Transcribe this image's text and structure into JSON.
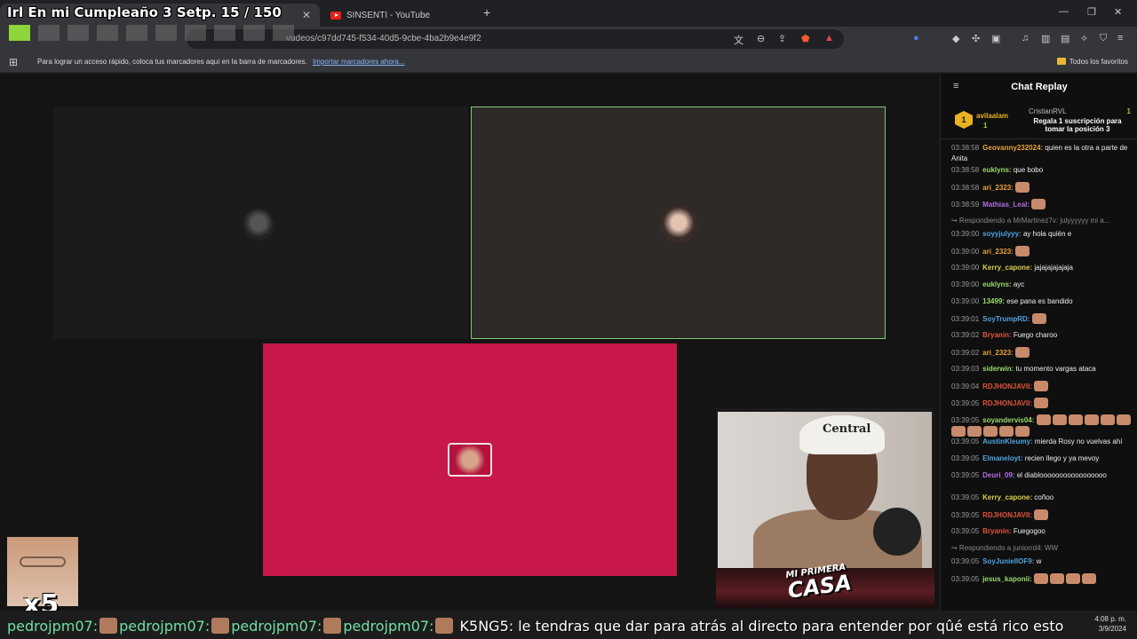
{
  "overlay": {
    "title": "Irl En mi Cumpleaño 3 Setp. 15 / 150",
    "progress_filled": 1,
    "progress_total": 10,
    "accent": "#8ed43b"
  },
  "browser": {
    "tabs": [
      {
        "label": "",
        "active": true
      },
      {
        "label": "SINSENTI - YouTube",
        "active": false
      }
    ],
    "new_tab_icon": "+",
    "url": "vudeos/c97dd745-f534-40d5-9cbe-4ba2b9e4e9f2",
    "bookmarks": {
      "hint": "Para lograr un acceso rápido, coloca tus marcadores aquí en la barra de marcadores.",
      "import": "Importar marcadores ahora...",
      "all": "Todos los favoritos"
    }
  },
  "call": {
    "active_border": "#7fc97a",
    "tile3_color": "#c8174a"
  },
  "webcam": {
    "cap_text": "Central",
    "brand_line1": "MI PRIMERA",
    "brand_line2": "CASA"
  },
  "smallcam": {
    "multiplier": "x5"
  },
  "chat": {
    "title": "Chat Replay",
    "pinned": {
      "rank": "1",
      "user": "avilaalam",
      "count": "1",
      "giver": "CristianRVL",
      "giver_count": "1",
      "message": "Regala 1 suscripción para tomar la posición 3"
    },
    "messages": [
      {
        "ts": "03:38:58",
        "user": "Geovanny232024",
        "color": "#e8a33b",
        "text": "quien es la otra a parte de Anita",
        "wrap": true
      },
      {
        "ts": "03:38:58",
        "user": "euklyns",
        "color": "#9ad96b",
        "text": "que bobo"
      },
      {
        "ts": "03:38:58",
        "user": "ari_2323",
        "color": "#e8a33b",
        "text": "",
        "emotes": 1
      },
      {
        "ts": "03:38:59",
        "user": "Mathias_Leal",
        "color": "#b46ee0",
        "text": "",
        "emotes": 1
      },
      {
        "reply": "Respondiendo a MrMartinez7v: julyyyyyy mi a..."
      },
      {
        "ts": "03:39:00",
        "user": "soyyjulyyy",
        "color": "#4fa3e0",
        "text": "ay hola quién e"
      },
      {
        "ts": "03:39:00",
        "user": "ari_2323",
        "color": "#e8a33b",
        "text": "",
        "emotes": 1
      },
      {
        "ts": "03:39:00",
        "user": "Kerry_capone",
        "color": "#d8d04a",
        "text": "jajajajajajaja"
      },
      {
        "ts": "03:39:00",
        "user": "euklyns",
        "color": "#9ad96b",
        "text": "ayc"
      },
      {
        "ts": "03:39:00",
        "user": "13499",
        "color": "#9ad96b",
        "text": "ese pana es bandido"
      },
      {
        "ts": "03:39:01",
        "user": "SoyTrumpRD",
        "color": "#4fa3e0",
        "text": "",
        "emotes": 1
      },
      {
        "ts": "03:39:02",
        "user": "Bryanin",
        "color": "#e0523b",
        "text": "Fuego charoo"
      },
      {
        "ts": "03:39:02",
        "user": "ari_2323",
        "color": "#e8a33b",
        "text": "",
        "emotes": 1
      },
      {
        "ts": "03:39:03",
        "user": "siderwin",
        "color": "#9ad96b",
        "text": "tu momento vargas ataca"
      },
      {
        "ts": "03:39:04",
        "user": "RDJHONJAVII",
        "color": "#e0523b",
        "text": "",
        "emotes": 1
      },
      {
        "ts": "03:39:05",
        "user": "RDJHONJAVII",
        "color": "#e0523b",
        "text": "",
        "emotes": 1
      },
      {
        "ts": "03:39:05",
        "user": "soyandervis04",
        "color": "#9ad96b",
        "text": "",
        "emotes": 11,
        "wrap": true
      },
      {
        "ts": "03:39:05",
        "user": "AustinKleumy",
        "color": "#4fa3e0",
        "text": "mierda Rosy no vuelvas ahí"
      },
      {
        "ts": "03:39:05",
        "user": "Elmaneloyt",
        "color": "#4fa3e0",
        "text": "recien llego y ya mevoy"
      },
      {
        "ts": "03:39:05",
        "user": "Deuri_09",
        "color": "#b46ee0",
        "text": "el diablooooooooooooooooo",
        "wrap": true
      },
      {
        "ts": "03:39:05",
        "user": "Kerry_capone",
        "color": "#d8d04a",
        "text": "coñoo"
      },
      {
        "ts": "03:39:05",
        "user": "RDJHONJAVII",
        "color": "#e0523b",
        "text": "",
        "emotes": 1
      },
      {
        "ts": "03:39:05",
        "user": "Bryanin",
        "color": "#e0523b",
        "text": "Fuegogoo"
      },
      {
        "reply": "Respondiendo a juniorrd4: WW"
      },
      {
        "ts": "03:39:05",
        "user": "SoyJuniellOF9",
        "color": "#4fa3e0",
        "text": "w"
      },
      {
        "ts": "03:39:05",
        "user": "jesus_kaponii",
        "color": "#9ad96b",
        "text": "",
        "emotes": 4
      }
    ]
  },
  "ticker": {
    "entries": [
      "pedrojpm07:",
      "pedrojpm07:",
      "pedrojpm07:",
      "pedrojpm07:"
    ],
    "user": "K5NG5:",
    "message": "le tendras que dar para atrás al directo para entender por qûé está rico esto",
    "time": "4:08 p. m.",
    "date": "3/9/2024"
  }
}
